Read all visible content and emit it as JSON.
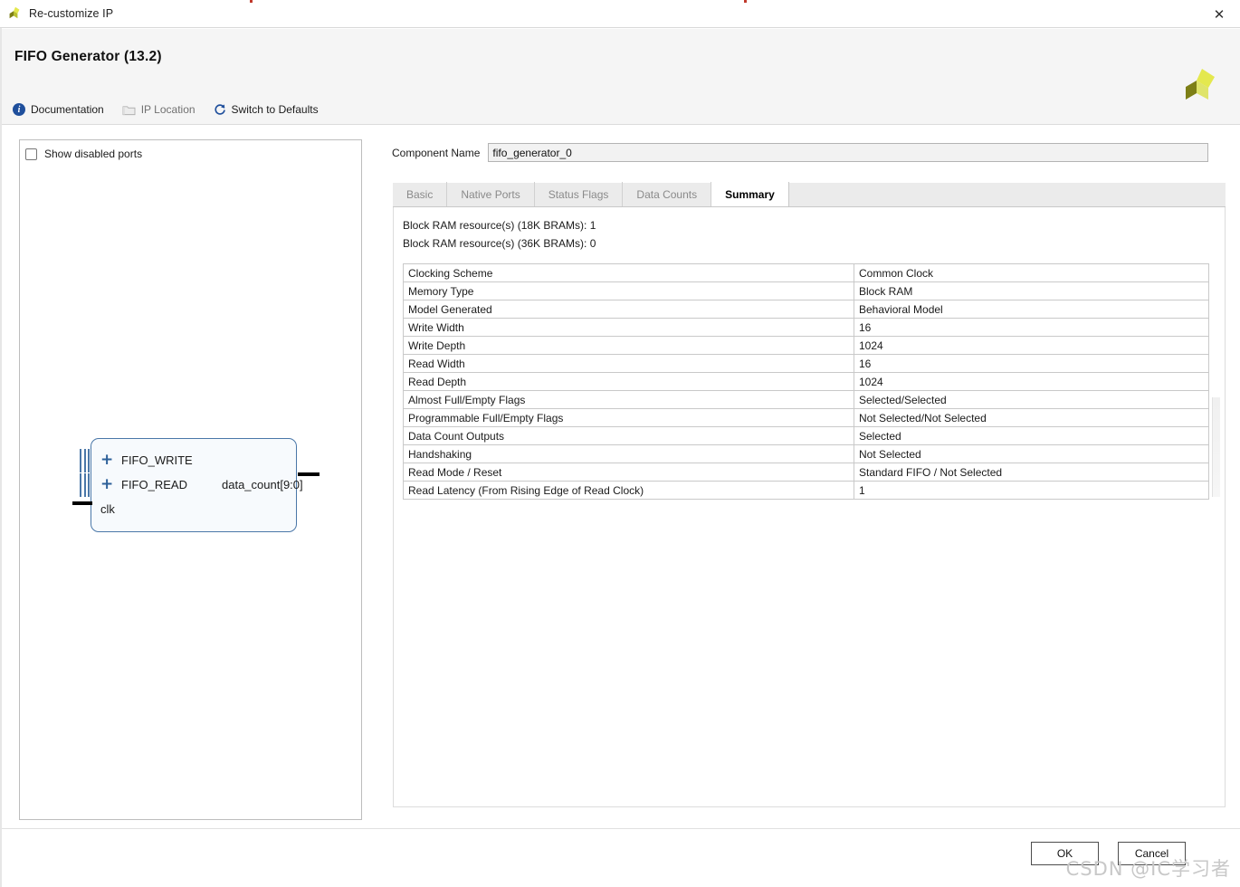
{
  "window": {
    "title": "Re-customize IP",
    "close_label": "✕",
    "app_icon": "xilinx-logo-icon"
  },
  "header": {
    "ip_title": "FIFO Generator (13.2)",
    "logo": "xilinx-logo-icon",
    "toolbar": [
      {
        "label": "Documentation",
        "icon": "info-icon",
        "disabled": false
      },
      {
        "label": "IP Location",
        "icon": "folder-icon",
        "disabled": true
      },
      {
        "label": "Switch to Defaults",
        "icon": "refresh-icon",
        "disabled": false
      }
    ]
  },
  "left_panel": {
    "show_disabled_ports": {
      "label": "Show disabled ports",
      "checked": false
    },
    "block_diagram": {
      "bus_ports": [
        {
          "name": "FIFO_WRITE",
          "expander": "+"
        },
        {
          "name": "FIFO_READ",
          "expander": "+"
        }
      ],
      "input_ports": [
        "clk"
      ],
      "output_ports": [
        "data_count[9:0]"
      ]
    }
  },
  "right_panel": {
    "component_name": {
      "label": "Component Name",
      "value": "fifo_generator_0"
    },
    "tabs": [
      {
        "label": "Basic",
        "active": false
      },
      {
        "label": "Native Ports",
        "active": false
      },
      {
        "label": "Status Flags",
        "active": false
      },
      {
        "label": "Data Counts",
        "active": false
      },
      {
        "label": "Summary",
        "active": true
      }
    ],
    "summary": {
      "bram_18k": "Block RAM resource(s) (18K BRAMs): 1",
      "bram_36k": "Block RAM resource(s) (36K BRAMs): 0",
      "rows": [
        {
          "key": "Clocking Scheme",
          "value": "Common Clock"
        },
        {
          "key": "Memory Type",
          "value": "Block RAM"
        },
        {
          "key": "Model Generated",
          "value": "Behavioral Model"
        },
        {
          "key": "Write Width",
          "value": "16"
        },
        {
          "key": "Write Depth",
          "value": "1024"
        },
        {
          "key": "Read Width",
          "value": "16"
        },
        {
          "key": "Read Depth",
          "value": "1024"
        },
        {
          "key": "Almost Full/Empty Flags",
          "value": "Selected/Selected"
        },
        {
          "key": "Programmable Full/Empty Flags",
          "value": "Not Selected/Not Selected"
        },
        {
          "key": "Data Count Outputs",
          "value": "Selected"
        },
        {
          "key": "Handshaking",
          "value": "Not Selected"
        },
        {
          "key": "Read Mode / Reset",
          "value": "Standard FIFO / Not Selected"
        },
        {
          "key": "Read Latency (From Rising Edge of Read Clock)",
          "value": "1"
        }
      ]
    }
  },
  "footer": {
    "ok_label": "OK",
    "cancel_label": "Cancel"
  },
  "watermark": "CSDN @IC学习者",
  "colors": {
    "accent_blue": "#1f4f9c",
    "block_border": "#4a77a8",
    "logo_olive": "#7d7f16",
    "logo_yellow": "#e4e84e",
    "header_bg": "#f5f5f5"
  }
}
